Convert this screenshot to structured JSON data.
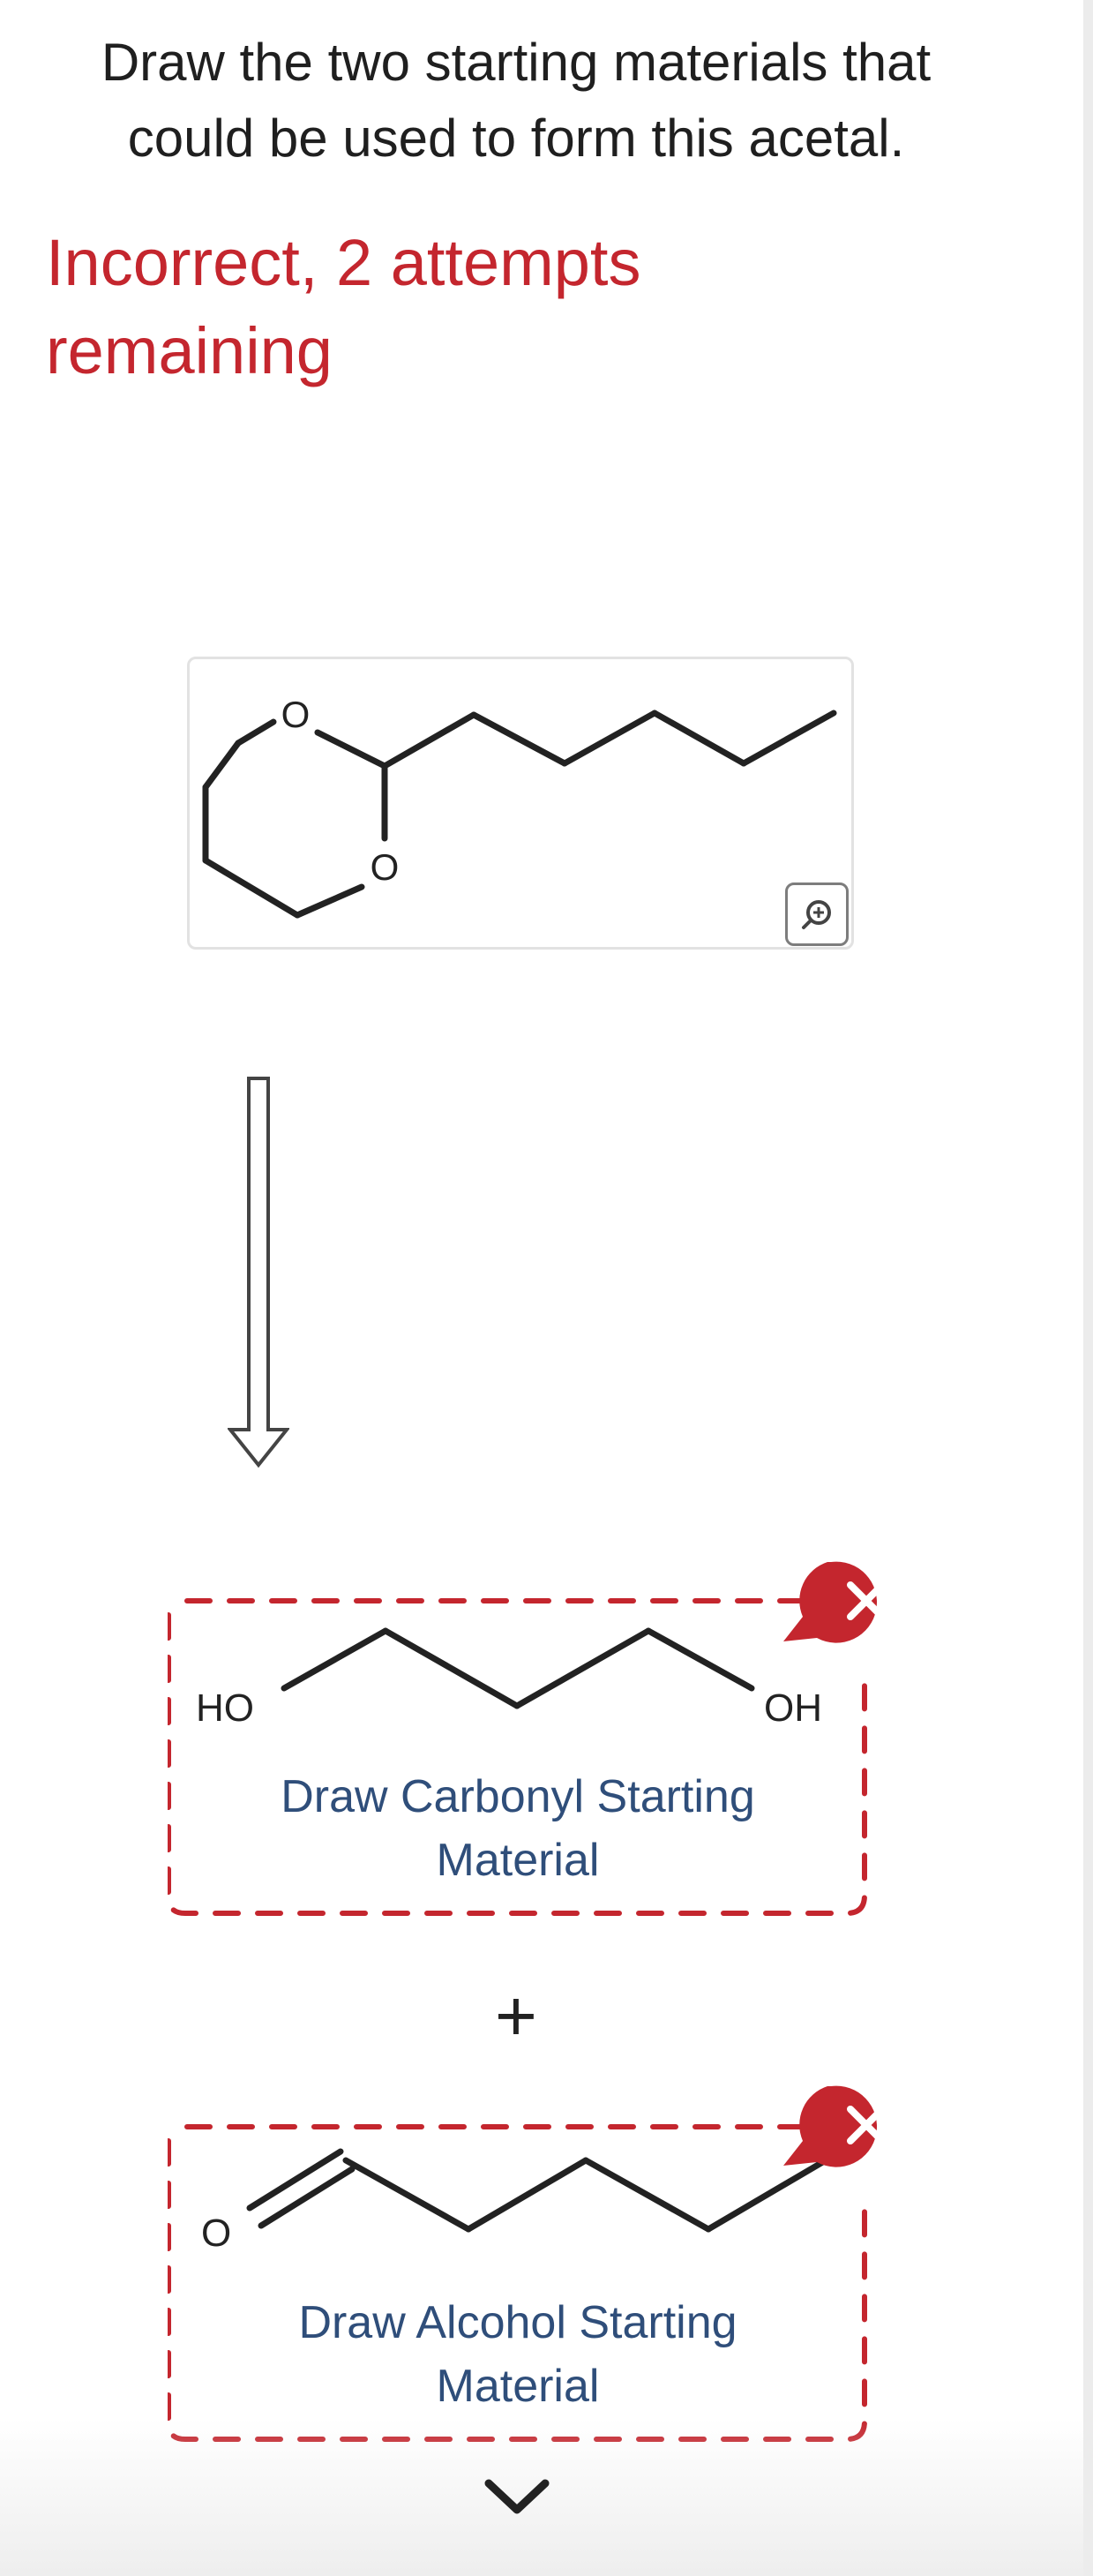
{
  "question": {
    "prompt_line1": "Draw the two starting materials that",
    "prompt_line2": "could be used to form this acetal."
  },
  "feedback": {
    "line1": "Incorrect, 2 attempts",
    "line2": "remaining",
    "color": "#c4262e"
  },
  "product": {
    "atom_o1": "O",
    "atom_o2": "O",
    "zoom_icon": "zoom-in-icon"
  },
  "carbonyl_box": {
    "atom_ho": "HO",
    "atom_oh": "OH",
    "label_line1": "Draw Carbonyl Starting",
    "label_line2": "Material",
    "remove_icon": "close-icon",
    "status_color": "#c4262e"
  },
  "plus_sign": "+",
  "alcohol_box": {
    "atom_o": "O",
    "label_line1": "Draw Alcohol Starting",
    "label_line2": "Material",
    "remove_icon": "close-icon",
    "status_color": "#c4262e"
  },
  "scroll": {
    "icon": "chevron-down-icon"
  }
}
